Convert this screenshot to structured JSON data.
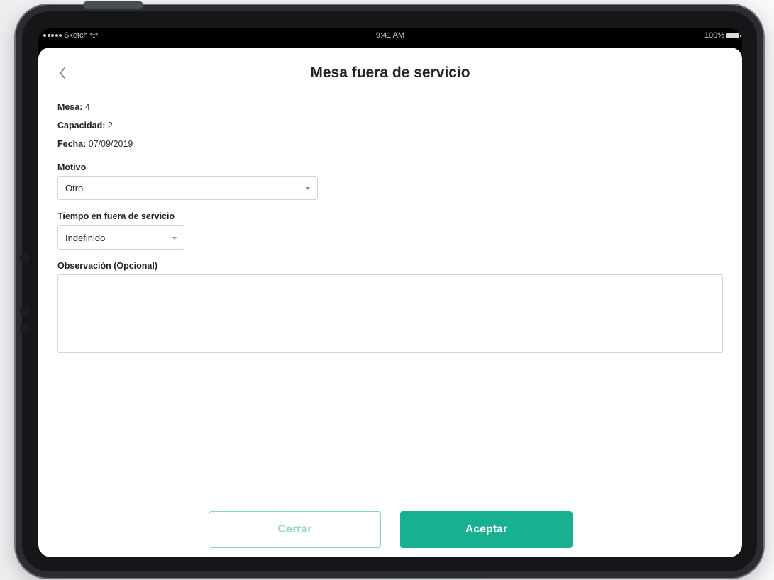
{
  "statusbar": {
    "carrier": "Sketch",
    "time": "9:41 AM",
    "battery": "100%"
  },
  "header": {
    "title": "Mesa fuera de servicio"
  },
  "info": {
    "mesa_label": "Mesa:",
    "mesa_value": "4",
    "capacidad_label": "Capacidad:",
    "capacidad_value": "2",
    "fecha_label": "Fecha:",
    "fecha_value": "07/09/2019"
  },
  "form": {
    "motivo_label": "Motivo",
    "motivo_value": "Otro",
    "tiempo_label": "Tiempo en fuera de servicio",
    "tiempo_value": "Indefinido",
    "observacion_label": "Observación (Opcional)",
    "observacion_value": ""
  },
  "actions": {
    "cerrar_label": "Cerrar",
    "aceptar_label": "Aceptar"
  },
  "colors": {
    "accent": "#17b192",
    "accent_light": "#7dd8c6",
    "border": "#cfd4d8"
  },
  "icons": {
    "back": "chevron-left-icon",
    "dropdown": "chevron-down-icon",
    "wifi": "wifi-icon",
    "battery": "battery-icon"
  }
}
